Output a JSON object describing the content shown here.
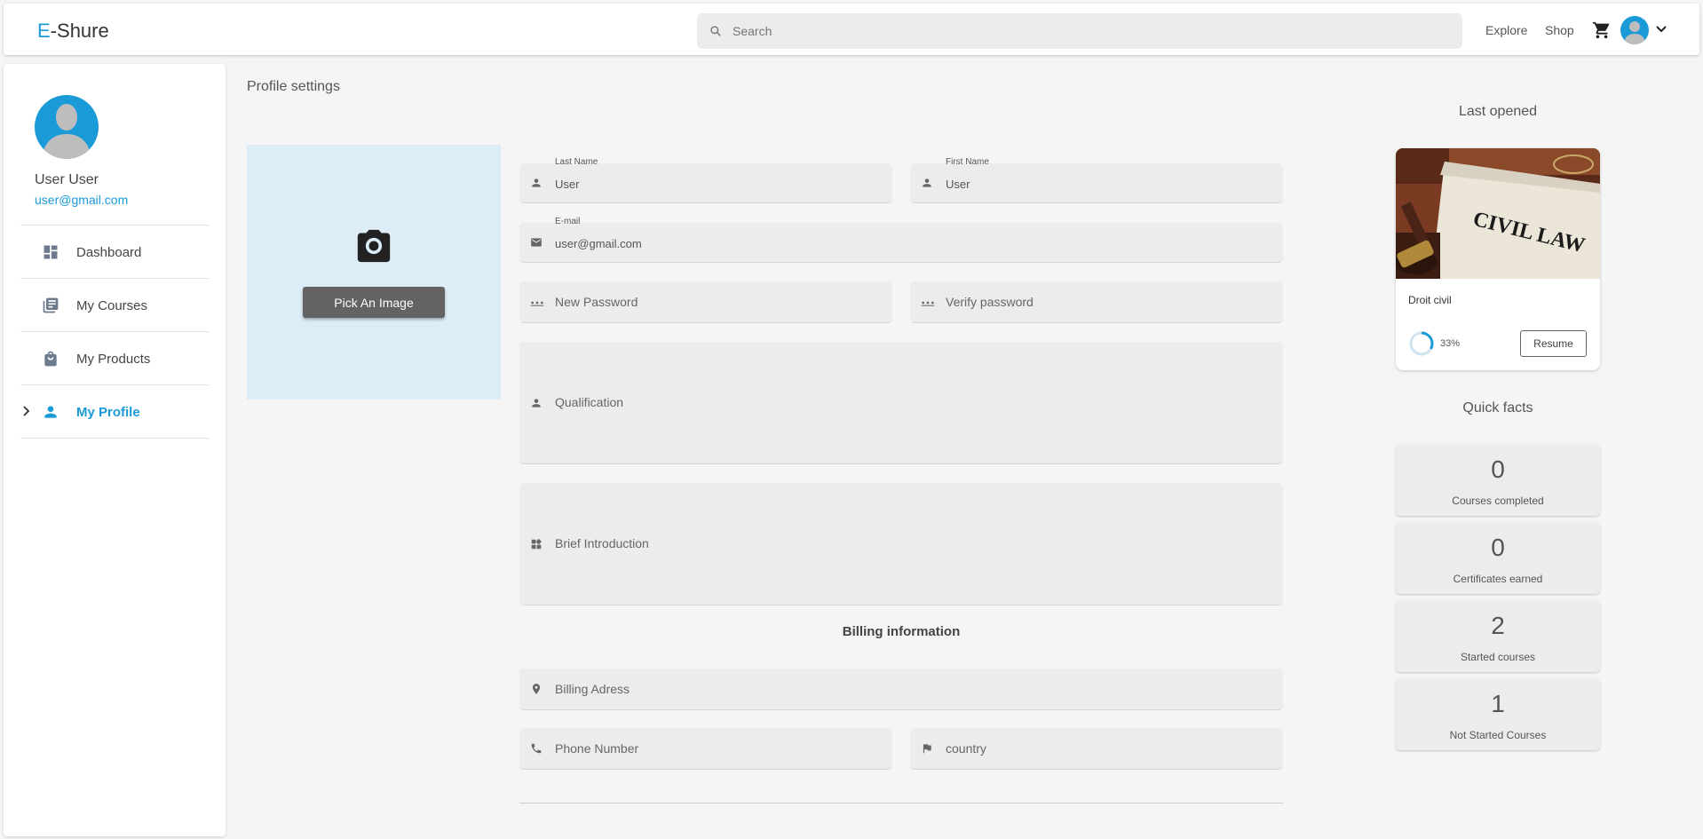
{
  "header": {
    "logo_e": "E",
    "logo_rest": "-Shure",
    "search_placeholder": "Search",
    "explore": "Explore",
    "shop": "Shop"
  },
  "sidebar": {
    "user_name": "User User",
    "user_email": "user@gmail.com",
    "items": [
      {
        "label": "Dashboard",
        "icon": "dashboard-icon"
      },
      {
        "label": "My Courses",
        "icon": "library-books-icon"
      },
      {
        "label": "My Products",
        "icon": "shopping-bag-icon"
      },
      {
        "label": "My Profile",
        "icon": "person-icon",
        "active": true
      }
    ]
  },
  "main": {
    "title": "Profile settings",
    "pick_image": "Pick An Image",
    "fields": {
      "last_name_label": "Last Name",
      "last_name_value": "User",
      "first_name_label": "First Name",
      "first_name_value": "User",
      "email_label": "E-mail",
      "email_value": "user@gmail.com",
      "new_password": "New Password",
      "verify_password": "Verify password",
      "qualification": "Qualification",
      "brief_intro": "Brief Introduction",
      "billing_address": "Billing Adress",
      "phone": "Phone Number",
      "country": "country"
    },
    "billing_title": "Billing information"
  },
  "right": {
    "last_opened_title": "Last opened",
    "course": {
      "image_text": "CIVIL LAW",
      "name": "Droit civil",
      "progress_label": "33%",
      "progress": 0.33,
      "resume": "Resume"
    },
    "quick_facts_title": "Quick facts",
    "facts": [
      {
        "value": "0",
        "label": "Courses completed"
      },
      {
        "value": "0",
        "label": "Certificates earned"
      },
      {
        "value": "2",
        "label": "Started courses"
      },
      {
        "value": "1",
        "label": "Not Started Courses"
      }
    ]
  },
  "colors": {
    "accent": "#1a9bd7",
    "image_box": "#dcedf8",
    "field_bg": "#ececec"
  }
}
